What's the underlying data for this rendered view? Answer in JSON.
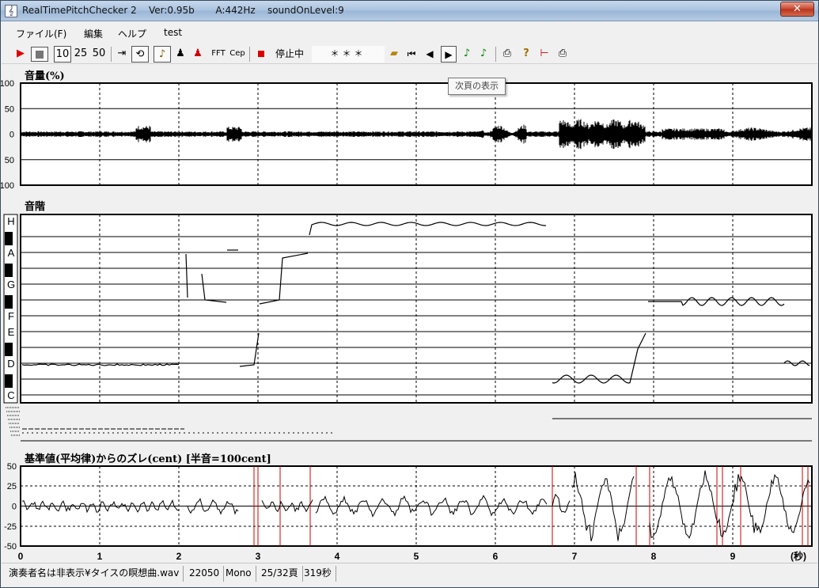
{
  "window": {
    "title": "RealTimePitchChecker 2    Ver:0.95b       A:442Hz    soundOnLevel:9",
    "close_label": "✕",
    "icon": "clef-icon"
  },
  "menu": {
    "items": [
      "ファイル(F)",
      "編集",
      "ヘルプ",
      "test"
    ]
  },
  "toolbar": {
    "speed_options": [
      "10",
      "25",
      "50"
    ],
    "fft_label": "FFT",
    "cep_label": "Cep",
    "status_label": "停止中",
    "display_value": "＊＊＊"
  },
  "tooltip": {
    "text": "次頁の表示"
  },
  "volume_chart": {
    "title": "音量(%)",
    "ticks": [
      "100",
      "50",
      "0",
      "50",
      "100"
    ]
  },
  "scale_chart": {
    "title": "音階",
    "notes": [
      "H",
      "A",
      "G",
      "F",
      "E",
      "D",
      "C"
    ]
  },
  "cent_chart": {
    "title": "基準値(平均律)からのズレ(cent) [半音=100cent]",
    "ticks": [
      "50",
      "25",
      "0",
      "-25",
      "-50"
    ]
  },
  "time_axis": {
    "ticks": [
      "0",
      "1",
      "2",
      "3",
      "4",
      "5",
      "6",
      "7",
      "8",
      "9"
    ],
    "unit": "(秒)"
  },
  "status": {
    "file": "演奏者名は非表示¥タイスの瞑想曲.wav",
    "rate": "22050",
    "channel": "Mono",
    "page": "25/32頁",
    "duration": "319秒"
  },
  "colors": {
    "trace": "#000000",
    "jump_line": "#cc0000",
    "grid": "#000000"
  }
}
